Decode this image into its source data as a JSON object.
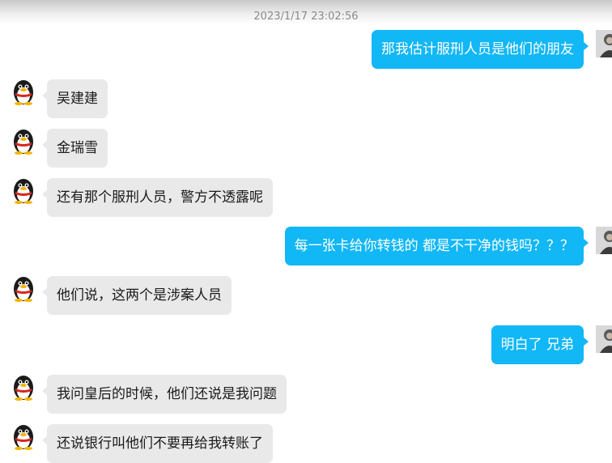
{
  "header": {
    "timestamp": "2023/1/17 23:02:56"
  },
  "messages": [
    {
      "side": "out",
      "text": "那我估计服刑人员是他们的朋友"
    },
    {
      "side": "in",
      "text": "吴建建"
    },
    {
      "side": "in",
      "text": "金瑞雪"
    },
    {
      "side": "in",
      "text": "还有那个服刑人员，警方不透露呢"
    },
    {
      "side": "out",
      "text": "每一张卡给你转钱的 都是不干净的钱吗？？？"
    },
    {
      "side": "in",
      "text": "他们说，这两个是涉案人员"
    },
    {
      "side": "out",
      "text": "明白了 兄弟"
    },
    {
      "side": "in",
      "text": "我问皇后的时候，他们还说是我问题"
    },
    {
      "side": "in",
      "text": "还说银行叫他们不要再给我转账了"
    }
  ],
  "icons": {
    "incoming_avatar": "qq-penguin-avatar-icon",
    "outgoing_avatar": "user-portrait-avatar-icon"
  },
  "colors": {
    "outgoing_bubble": "#12b7f5",
    "incoming_bubble": "#e9e9e9"
  }
}
